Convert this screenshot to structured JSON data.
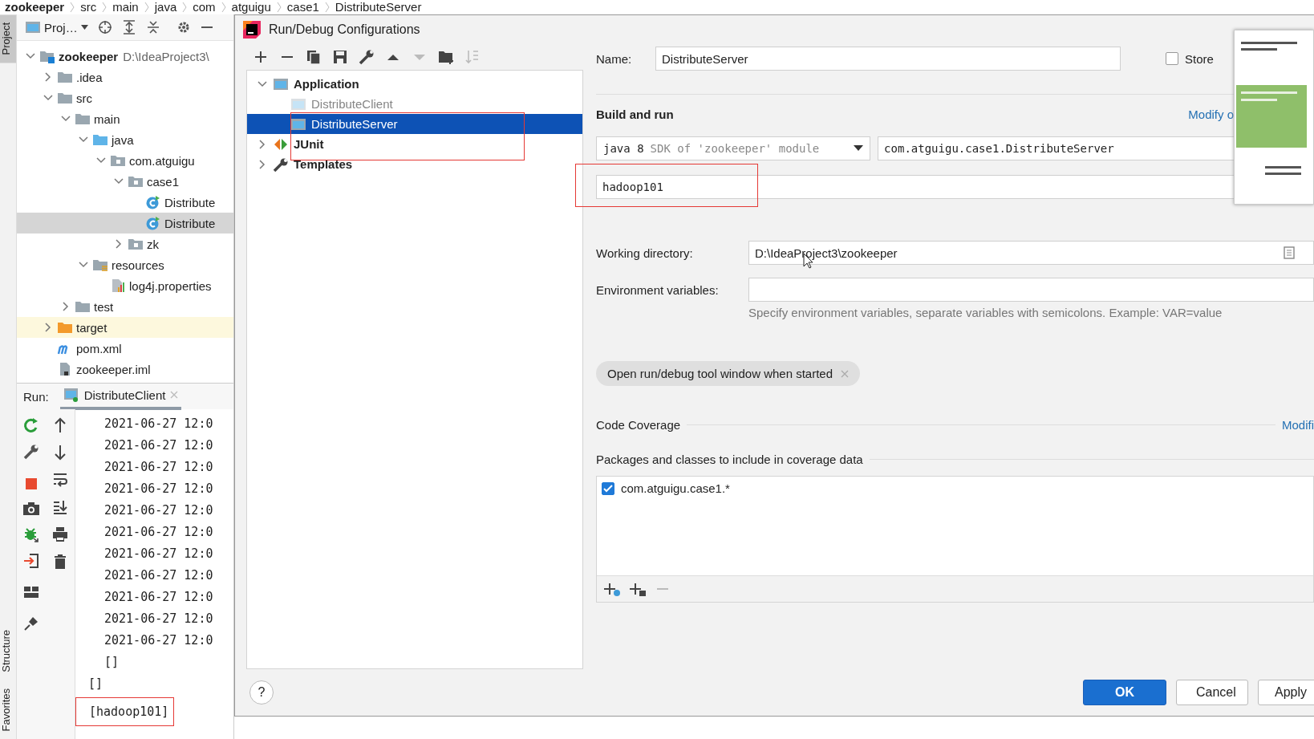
{
  "breadcrumbs": [
    "zookeeper",
    "src",
    "main",
    "java",
    "com",
    "atguigu",
    "case1",
    "DistributeServer"
  ],
  "left_strip": {
    "top": [
      {
        "label": "Project",
        "selected": true
      }
    ],
    "bottom": [
      {
        "label": "Structure",
        "selected": false
      },
      {
        "label": "Favorites",
        "selected": false
      }
    ]
  },
  "project_pane": {
    "view_label": "Proj…",
    "tree": [
      {
        "label": "zookeeper",
        "path": "D:\\IdeaProject3\\",
        "kind": "module",
        "expanded": true,
        "selected": false,
        "children": [
          {
            "label": ".idea",
            "kind": "folder",
            "expanded": false,
            "selected": false
          },
          {
            "label": "src",
            "kind": "folder",
            "expanded": true,
            "selected": false,
            "children": [
              {
                "label": "main",
                "kind": "folder",
                "expanded": true,
                "selected": false,
                "children": [
                  {
                    "label": "java",
                    "kind": "source-root",
                    "expanded": true,
                    "selected": false,
                    "children": [
                      {
                        "label": "com.atguigu",
                        "kind": "package",
                        "expanded": true,
                        "selected": false,
                        "children": [
                          {
                            "label": "case1",
                            "kind": "package",
                            "expanded": true,
                            "selected": false,
                            "children": [
                              {
                                "label": "Distribute",
                                "kind": "class",
                                "selected": false
                              },
                              {
                                "label": "Distribute",
                                "kind": "class",
                                "selected": true
                              }
                            ]
                          },
                          {
                            "label": "zk",
                            "kind": "package",
                            "expanded": false,
                            "selected": false
                          }
                        ]
                      }
                    ]
                  },
                  {
                    "label": "resources",
                    "kind": "resources",
                    "expanded": true,
                    "selected": false,
                    "children": [
                      {
                        "label": "log4j.properties",
                        "kind": "properties",
                        "selected": false
                      }
                    ]
                  }
                ]
              },
              {
                "label": "test",
                "kind": "folder",
                "expanded": false,
                "selected": false
              }
            ]
          },
          {
            "label": "target",
            "kind": "excluded",
            "expanded": false,
            "selected": false
          },
          {
            "label": "pom.xml",
            "kind": "maven",
            "selected": false
          },
          {
            "label": "zookeeper.iml",
            "kind": "iml",
            "selected": false
          }
        ]
      }
    ]
  },
  "run_pane": {
    "label": "Run:",
    "tab": {
      "label": "DistributeClient",
      "selected": true
    },
    "console": [
      {
        "text": "2021-06-27 12:0",
        "indented": true,
        "annotated": false
      },
      {
        "text": "2021-06-27 12:0",
        "indented": true,
        "annotated": false
      },
      {
        "text": "2021-06-27 12:0",
        "indented": true,
        "annotated": false
      },
      {
        "text": "2021-06-27 12:0",
        "indented": true,
        "annotated": false
      },
      {
        "text": "2021-06-27 12:0",
        "indented": true,
        "annotated": false
      },
      {
        "text": "2021-06-27 12:0",
        "indented": true,
        "annotated": false
      },
      {
        "text": "2021-06-27 12:0",
        "indented": true,
        "annotated": false
      },
      {
        "text": "2021-06-27 12:0",
        "indented": true,
        "annotated": false
      },
      {
        "text": "2021-06-27 12:0",
        "indented": true,
        "annotated": false
      },
      {
        "text": "2021-06-27 12:0",
        "indented": true,
        "annotated": false
      },
      {
        "text": "2021-06-27 12:0",
        "indented": true,
        "annotated": false
      },
      {
        "text": "[]",
        "indented": true,
        "annotated": false
      },
      {
        "text": "[]",
        "indented": false,
        "annotated": false
      },
      {
        "text": "[hadoop101]",
        "indented": false,
        "annotated": true
      }
    ]
  },
  "dialog": {
    "title": "Run/Debug Configurations",
    "toolbar": [
      {
        "kind": "add",
        "disabled": false
      },
      {
        "kind": "remove",
        "disabled": false
      },
      {
        "kind": "copy",
        "disabled": false
      },
      {
        "kind": "save",
        "disabled": false
      },
      {
        "kind": "wrench",
        "disabled": false
      },
      {
        "kind": "up",
        "disabled": false
      },
      {
        "kind": "down",
        "disabled": true
      },
      {
        "kind": "new-folder",
        "disabled": false
      },
      {
        "kind": "sort",
        "disabled": true
      }
    ],
    "configurations": [
      {
        "label": "Application",
        "kind": "application",
        "expanded": true,
        "selected": false,
        "children": [
          {
            "label": "DistributeClient",
            "kind": "config",
            "temporary": true,
            "selected": false,
            "annotated": false
          },
          {
            "label": "DistributeServer",
            "kind": "config",
            "temporary": false,
            "selected": true,
            "annotated": true
          }
        ]
      },
      {
        "label": "JUnit",
        "kind": "junit",
        "expanded": false,
        "selected": false
      },
      {
        "label": "Templates",
        "kind": "templates",
        "expanded": false,
        "selected": false
      }
    ],
    "name": {
      "label": "Name:",
      "value": "DistributeServer"
    },
    "store": {
      "label": "Store",
      "checked": false
    },
    "build_run": {
      "title": "Build and run",
      "modify_link": "Modify o",
      "jre": {
        "value": "java 8",
        "hint": "SDK of 'zookeeper' module"
      },
      "main_class": "com.atguigu.case1.DistributeServer",
      "program_args": {
        "value": "hadoop101",
        "annotated": true
      }
    },
    "working_directory": {
      "label": "Working directory:",
      "value": "D:\\IdeaProject3\\zookeeper"
    },
    "environment": {
      "label": "Environment variables:",
      "hint": "Specify environment variables, separate variables with semicolons. Example: VAR=value"
    },
    "chip": {
      "label": "Open run/debug tool window when started"
    },
    "coverage": {
      "title": "Code Coverage",
      "modify_link": "Modifi",
      "packages_title": "Packages and classes to include in coverage data",
      "patterns": [
        {
          "label": "com.atguigu.case1.*",
          "checked": true
        }
      ],
      "toolbar": [
        {
          "kind": "add-class",
          "disabled": false
        },
        {
          "kind": "add-package",
          "disabled": false
        },
        {
          "kind": "remove",
          "disabled": true
        }
      ]
    },
    "help": "?",
    "buttons": [
      {
        "label": "OK",
        "kind": "primary"
      },
      {
        "label": "Cancel",
        "kind": "secondary"
      },
      {
        "label": "Apply",
        "kind": "secondary"
      }
    ]
  }
}
